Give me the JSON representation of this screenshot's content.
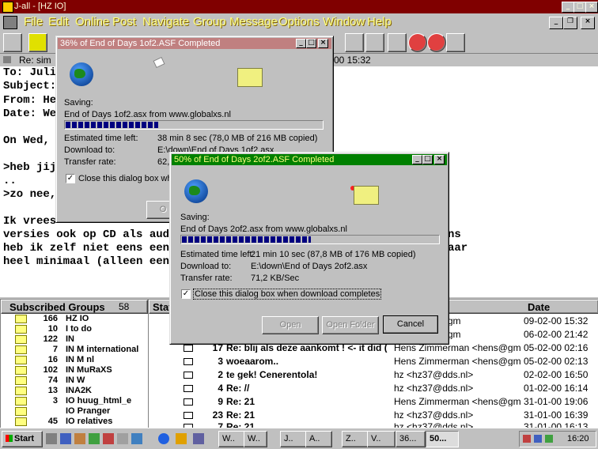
{
  "app": {
    "title": "J-all - [HZ IO]",
    "menu": [
      "File",
      "Edit",
      "Online",
      "Post",
      "Navigate",
      "Group",
      "Message",
      "Options",
      "Window",
      "Help"
    ]
  },
  "message": {
    "title_left": "Re: sim",
    "title_right": "00 15:32",
    "lines": [
      "To: Juli",
      "Subject:",
      "From: He",
      "Date: We",
      "",
      "On Wed,",
      "",
      ">heb jij",
      "..",
      ">zo nee,",
      "",
      "Ik vrees",
      "versies ook op CD als aud",
      "heb ik zelf niet eens een",
      "heel minimaal (alleen een"
    ],
    "right_fragments": [
      {
        "line": 12,
        "text": "ns"
      },
      {
        "line": 13,
        "text": "aar"
      }
    ]
  },
  "groups": {
    "header": "Subscribed Groups",
    "header_count": "58",
    "items": [
      {
        "count": "166",
        "name": "HZ IO"
      },
      {
        "count": "10",
        "name": "I to do"
      },
      {
        "count": "122",
        "name": "IN"
      },
      {
        "count": "7",
        "name": "IN M international"
      },
      {
        "count": "16",
        "name": "IN M nl"
      },
      {
        "count": "102",
        "name": "IN MuRaXS"
      },
      {
        "count": "74",
        "name": "IN W"
      },
      {
        "count": "13",
        "name": "INA2K"
      },
      {
        "count": "3",
        "name": "IO huug_html_e"
      },
      {
        "count": "",
        "name": "IO Pranger"
      },
      {
        "count": "45",
        "name": "IO relatives"
      }
    ]
  },
  "messages": {
    "col_status": "Stat",
    "col_date": "Date",
    "rows": [
      {
        "lines": "",
        "subject": "",
        "from": "rman <hens@gm",
        "date": "09-02-00 15:32"
      },
      {
        "lines": "",
        "subject": "",
        "from": "rman <hens@gm",
        "date": "06-02-00 21:42"
      },
      {
        "lines": "17",
        "subject": "Re: blij als deze aankomt ! <- it did (",
        "from": "Hens Zimmerman <hens@gm",
        "date": "05-02-00 02:16"
      },
      {
        "lines": "3",
        "subject": "woeaarom..",
        "from": "Hens Zimmerman <hens@gm",
        "date": "05-02-00 02:13"
      },
      {
        "lines": "2",
        "subject": "te gek! Cenerentola!",
        "from": "hz <hz37@dds.nl>",
        "date": "02-02-00 16:50"
      },
      {
        "lines": "4",
        "subject": "Re: //",
        "from": "hz <hz37@dds.nl>",
        "date": "01-02-00 16:14"
      },
      {
        "lines": "9",
        "subject": "Re: 21",
        "from": "Hens Zimmerman <hens@gm",
        "date": "31-01-00 19:06"
      },
      {
        "lines": "23",
        "subject": "Re: 21",
        "from": "hz <hz37@dds.nl>",
        "date": "31-01-00 16:39"
      },
      {
        "lines": "7",
        "subject": "Re: 21",
        "from": "hz <hz37@dds.nl>",
        "date": "31-01-00 16:13"
      }
    ]
  },
  "dialog1": {
    "title": "36% of End of Days 1of2.ASF Completed",
    "saving_label": "Saving:",
    "file": "End of Days 1of2.asx from www.globalxs.nl",
    "progress": 0.36,
    "time_label": "Estimated time left:",
    "time_value": "38 min 8 sec (78,0 MB of 216 MB copied)",
    "download_label": "Download to:",
    "download_value": "E:\\down\\End of Days 1of2.asx",
    "rate_label": "Transfer rate:",
    "rate_value": "62,4 KB/S",
    "close_check": "Close this dialog box when",
    "open_btn_partial": "O"
  },
  "dialog2": {
    "title": "50% of End of Days 2of2.ASF Completed",
    "saving_label": "Saving:",
    "file": "End of Days 2of2.asx from www.globalxs.nl",
    "progress": 0.5,
    "time_label": "Estimated time left:",
    "time_value": "21 min 10 sec (87,8 MB of 176 MB copied)",
    "download_label": "Download to:",
    "download_value": "E:\\down\\End of Days 2of2.asx",
    "rate_label": "Transfer rate:",
    "rate_value": "71,2 KB/Sec",
    "close_check": "Close this dialog box when download completes",
    "btn_open": "Open",
    "btn_open_folder": "Open Folder",
    "btn_cancel": "Cancel"
  },
  "taskbar": {
    "start": "Start",
    "tasks": [
      "W..",
      "W..",
      "J..",
      "A..",
      "Z..",
      "V..",
      "36...",
      "50..."
    ],
    "clock": "16:20"
  },
  "colors": {
    "app_title_bg": "#800000",
    "dialog_title_active": "#008000",
    "dialog_title_inactive": "#c08080",
    "menu_text": "#ffff80",
    "progress": "#000080"
  }
}
